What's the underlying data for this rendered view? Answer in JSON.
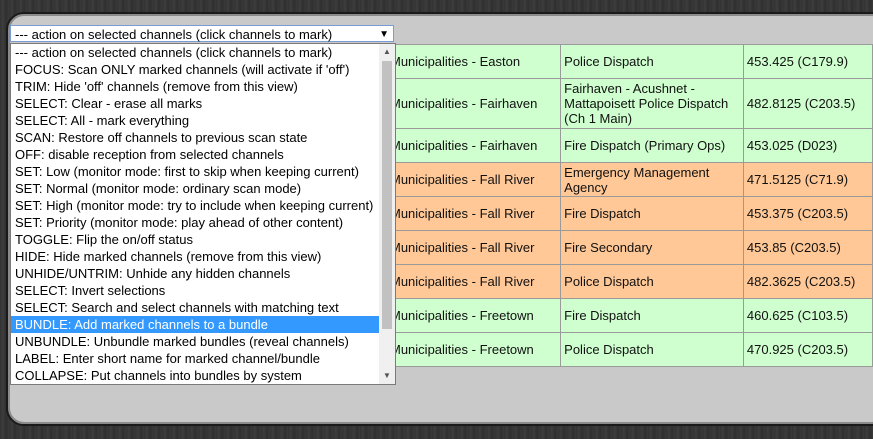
{
  "action_select": {
    "value": "--- action on selected channels (click channels to mark)",
    "options": [
      "--- action on selected channels (click channels to mark)",
      "FOCUS: Scan ONLY marked channels (will activate if 'off')",
      "TRIM: Hide 'off' channels (remove from this view)",
      "SELECT: Clear - erase all marks",
      "SELECT: All - mark everything",
      "SCAN: Restore off channels to previous scan state",
      "OFF: disable reception from selected channels",
      "SET: Low (monitor mode: first to skip when keeping current)",
      "SET: Normal (monitor mode: ordinary scan mode)",
      "SET: High (monitor mode: try to include when keeping current)",
      "SET: Priority (monitor mode: play ahead of other content)",
      "TOGGLE: Flip the on/off status",
      "HIDE: Hide marked channels (remove from this view)",
      "UNHIDE/UNTRIM: Unhide any hidden channels",
      "SELECT: Invert selections",
      "SELECT: Search and select channels with matching text",
      "BUNDLE: Add marked channels to a bundle",
      "UNBUNDLE: Unbundle marked bundles (reveal channels)",
      "LABEL: Enter short name for marked channel/bundle",
      "COLLAPSE: Put channels into bundles by system"
    ],
    "highlighted_index": 16
  },
  "channels": [
    {
      "agency": "Municipalities - Easton",
      "desc": "Police Dispatch",
      "freq": "453.425 (C179.9)",
      "status": "green"
    },
    {
      "agency": "Municipalities - Fairhaven",
      "desc": "Fairhaven - Acushnet - Mattapoisett Police Dispatch (Ch 1 Main)",
      "freq": "482.8125 (C203.5)",
      "status": "green"
    },
    {
      "agency": "Municipalities - Fairhaven",
      "desc": "Fire Dispatch (Primary Ops)",
      "freq": "453.025 (D023)",
      "status": "green"
    },
    {
      "agency": "Municipalities - Fall River",
      "desc": "Emergency Management Agency",
      "freq": "471.5125 (C71.9)",
      "status": "orange"
    },
    {
      "agency": "Municipalities - Fall River",
      "desc": "Fire Dispatch",
      "freq": "453.375 (C203.5)",
      "status": "orange"
    },
    {
      "agency": "Municipalities - Fall River",
      "desc": "Fire Secondary",
      "freq": "453.85 (C203.5)",
      "status": "orange"
    },
    {
      "agency": "Municipalities - Fall River",
      "desc": "Police Dispatch",
      "freq": "482.3625 (C203.5)",
      "status": "orange"
    },
    {
      "agency": "Municipalities - Freetown",
      "desc": "Fire Dispatch",
      "freq": "460.625 (C103.5)",
      "status": "green"
    },
    {
      "agency": "Municipalities - Freetown",
      "desc": "Police Dispatch",
      "freq": "470.925 (C203.5)",
      "status": "green"
    }
  ],
  "colors": {
    "green": "#cfffcf",
    "orange": "#ffc896",
    "highlight": "#3399ff"
  }
}
